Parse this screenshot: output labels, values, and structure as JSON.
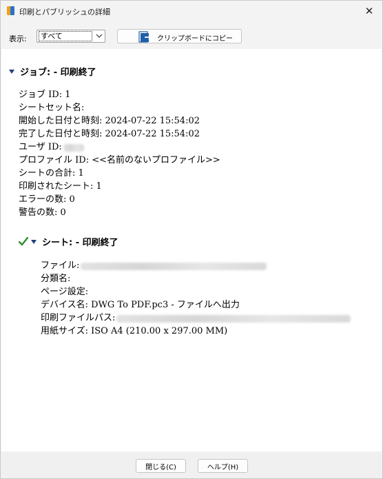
{
  "window": {
    "title": "印刷とパブリッシュの詳細",
    "close_glyph": "✕"
  },
  "toolbar": {
    "show_label": "表示:",
    "filter_value": "すべて",
    "copy_label": "クリップボードにコピー"
  },
  "job": {
    "heading": "ジョブ: - 印刷終了",
    "fields": [
      {
        "label": "ジョブ ID:",
        "value": "1"
      },
      {
        "label": "シートセット名:",
        "value": ""
      },
      {
        "label": "開始した日付と時刻:",
        "value": "2024-07-22 15:54:02"
      },
      {
        "label": "完了した日付と時刻:",
        "value": "2024-07-22 15:54:02"
      },
      {
        "label": "ユーザ ID:",
        "value": ""
      },
      {
        "label": "プロファイル ID:",
        "value": "<<名前のないプロファイル>>"
      },
      {
        "label": "シートの合計:",
        "value": "1"
      },
      {
        "label": "印刷されたシート:",
        "value": "1"
      },
      {
        "label": "エラーの数:",
        "value": "0"
      },
      {
        "label": "警告の数:",
        "value": "0"
      }
    ]
  },
  "sheet": {
    "heading": "シート: - 印刷終了",
    "fields": [
      {
        "label": "ファイル:",
        "value": ""
      },
      {
        "label": "分類名:",
        "value": ""
      },
      {
        "label": "ページ設定:",
        "value": ""
      },
      {
        "label": "デバイス名:",
        "value": "DWG To PDF.pc3 - ファイルへ出力"
      },
      {
        "label": "印刷ファイルパス:",
        "value": ""
      },
      {
        "label": "用紙サイズ:",
        "value": "ISO A4 (210.00 x 297.00 MM)"
      }
    ]
  },
  "footer": {
    "close_label": "閉じる(C)",
    "help_label": "ヘルプ(H)"
  },
  "icons": {
    "app": "app-icon",
    "expand": "triangle-down-icon",
    "success": "checkmark-icon",
    "copy": "clipboard-copy-icon",
    "dropdown": "chevron-down-icon"
  },
  "colors": {
    "accent": "#1e5fa8",
    "check": "#2e8b2e",
    "content_bg": "#ffffff",
    "window_bg": "#f3f3f3"
  }
}
